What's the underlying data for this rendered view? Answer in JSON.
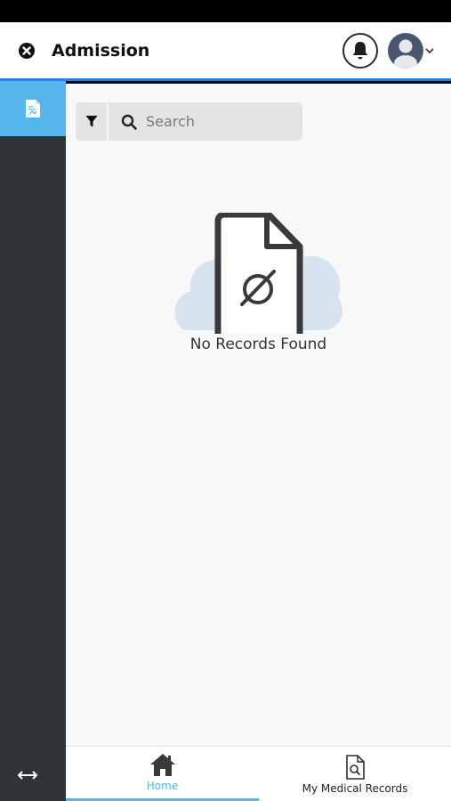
{
  "header": {
    "title": "Admission",
    "close_icon": "close-circle-icon",
    "bell_icon": "bell-icon",
    "avatar_icon": "user-avatar-icon"
  },
  "sidebar": {
    "items": [
      {
        "icon": "pdf-document-icon",
        "active": true
      }
    ],
    "expand_icon": "horizontal-arrows-icon"
  },
  "toolbar": {
    "filter_icon": "filter-icon",
    "search_placeholder": "Search",
    "search_value": ""
  },
  "empty_state": {
    "icon": "empty-document-cloud-icon",
    "message": "No Records Found"
  },
  "bottom_nav": {
    "items": [
      {
        "label": "Home",
        "icon": "home-icon",
        "active": true
      },
      {
        "label": "My Medical Records",
        "icon": "document-search-icon",
        "active": false
      }
    ]
  },
  "colors": {
    "accent": "#54b6ea",
    "header_border": "#2f7de1",
    "sidebar_bg": "#2d3337"
  }
}
